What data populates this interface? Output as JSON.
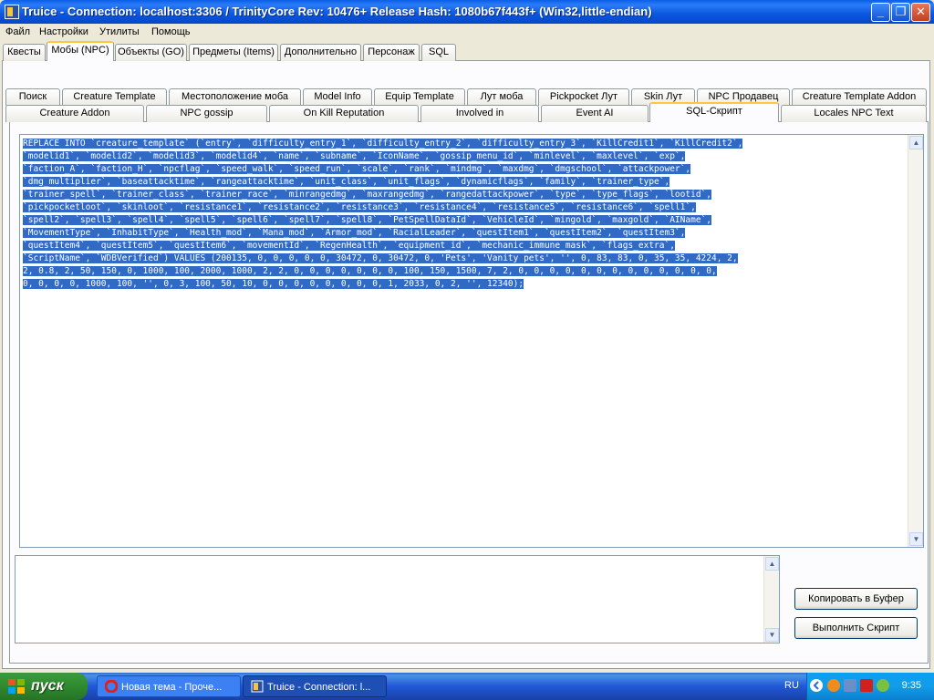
{
  "window": {
    "title": "Truice - Connection: localhost:3306 / TrinityCore Rev: 10476+ Release Hash: 1080b67f443f+ (Win32,little-endian)"
  },
  "menu": [
    "Файл",
    "Настройки",
    "Утилиты",
    "Помощь"
  ],
  "main_tabs": [
    "Квесты",
    "Мобы (NPC)",
    "Объекты (GO)",
    "Предметы (Items)",
    "Дополнительно",
    "Персонаж",
    "SQL"
  ],
  "main_tab_active": "Мобы (NPC)",
  "sub_tabs_row1": [
    "Поиск",
    "Creature Template",
    "Местоположение моба",
    "Model Info",
    "Equip Template",
    "Лут моба",
    "Pickpocket Лут",
    "Skin Лут",
    "NPC Продавец",
    "Creature Template Addon"
  ],
  "sub_tabs_row2": [
    "Creature Addon",
    "NPC gossip",
    "On Kill Reputation",
    "Involved in",
    "Event AI",
    "SQL-Скрипт",
    "Locales NPC Text"
  ],
  "sub_tab_active": "SQL-Скрипт",
  "sql_lines": [
    "REPLACE INTO `creature_template` (`entry`, `difficulty_entry_1`, `difficulty_entry_2`, `difficulty_entry_3`, `KillCredit1`, `KillCredit2`,",
    "`modelid1`, `modelid2`, `modelid3`, `modelid4`, `name`, `subname`, `IconName`, `gossip_menu_id`, `minlevel`, `maxlevel`, `exp`,",
    "`faction_A`, `faction_H`, `npcflag`, `speed_walk`, `speed_run`, `scale`, `rank`, `mindmg`, `maxdmg`, `dmgschool`, `attackpower`,",
    "`dmg_multiplier`, `baseattacktime`, `rangeattacktime`, `unit_class`, `unit_flags`, `dynamicflags`, `family`, `trainer_type`,",
    "`trainer_spell`, `trainer_class`, `trainer_race`, `minrangedmg`, `maxrangedmg`, `rangedattackpower`, `type`, `type_flags`, `lootid`,",
    "`pickpocketloot`, `skinloot`, `resistance1`, `resistance2`, `resistance3`, `resistance4`, `resistance5`, `resistance6`, `spell1`,",
    "`spell2`, `spell3`, `spell4`, `spell5`, `spell6`, `spell7`, `spell8`, `PetSpellDataId`, `VehicleId`, `mingold`, `maxgold`, `AIName`,",
    "`MovementType`, `InhabitType`, `Health_mod`, `Mana_mod`, `Armor_mod`, `RacialLeader`, `questItem1`, `questItem2`, `questItem3`,",
    "`questItem4`, `questItem5`, `questItem6`, `movementId`, `RegenHealth`, `equipment_id`, `mechanic_immune_mask`, `flags_extra`,",
    "`ScriptName`, `WDBVerified`) VALUES (200135, 0, 0, 0, 0, 0, 30472, 0, 30472, 0, 'Pets', 'Vanity pets', '', 0, 83, 83, 0, 35, 35, 4224, 2,",
    "2, 0.8, 2, 50, 150, 0, 1000, 100, 2000, 1000, 2, 2, 0, 0, 0, 0, 0, 0, 0, 100, 150, 1500, 7, 2, 0, 0, 0, 0, 0, 0, 0, 0, 0, 0, 0, 0, 0,",
    "0, 0, 0, 0, 1000, 100, '', 0, 3, 100, 50, 10, 0, 0, 0, 0, 0, 0, 0, 0, 1, 2033, 0, 2, '', 12340);"
  ],
  "buttons": {
    "copy": "Копировать в Буфер",
    "execute": "Выполнить Скрипт"
  },
  "taskbar": {
    "start": "пуск",
    "task1": "Новая тема - Проче...",
    "task2": "Truice - Connection: l...",
    "lang": "RU",
    "clock": "9:35"
  }
}
